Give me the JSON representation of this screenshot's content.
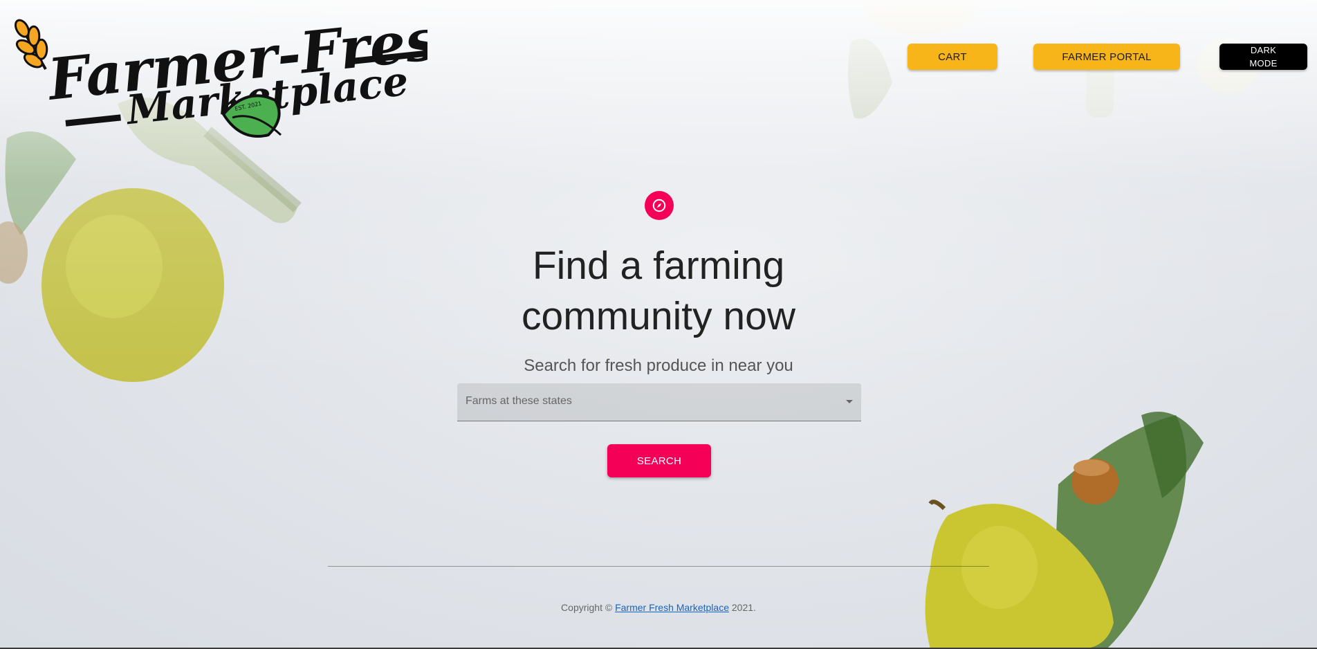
{
  "brand": {
    "logo_line1": "Farmer-Fresh",
    "logo_line2": "Marketplace",
    "logo_badge": "EST. 2021"
  },
  "nav": {
    "cart_label": "CART",
    "portal_label": "FARMER PORTAL",
    "dark_mode_line1": "DARK",
    "dark_mode_line2": "MODE"
  },
  "hero": {
    "icon": "compass-icon",
    "title_line1": "Find a farming",
    "title_line2": "community now",
    "subtitle": "Search for fresh produce in near you",
    "select_label": "Farms at these states",
    "search_label": "SEARCH"
  },
  "footer": {
    "copyright_prefix": "Copyright © ",
    "link_text": "Farmer Fresh Marketplace",
    "copyright_suffix": " 2021."
  },
  "colors": {
    "accent": "#f50057",
    "nav_button": "#f8b51a",
    "dark_button": "#000000",
    "link": "#1565c0"
  }
}
